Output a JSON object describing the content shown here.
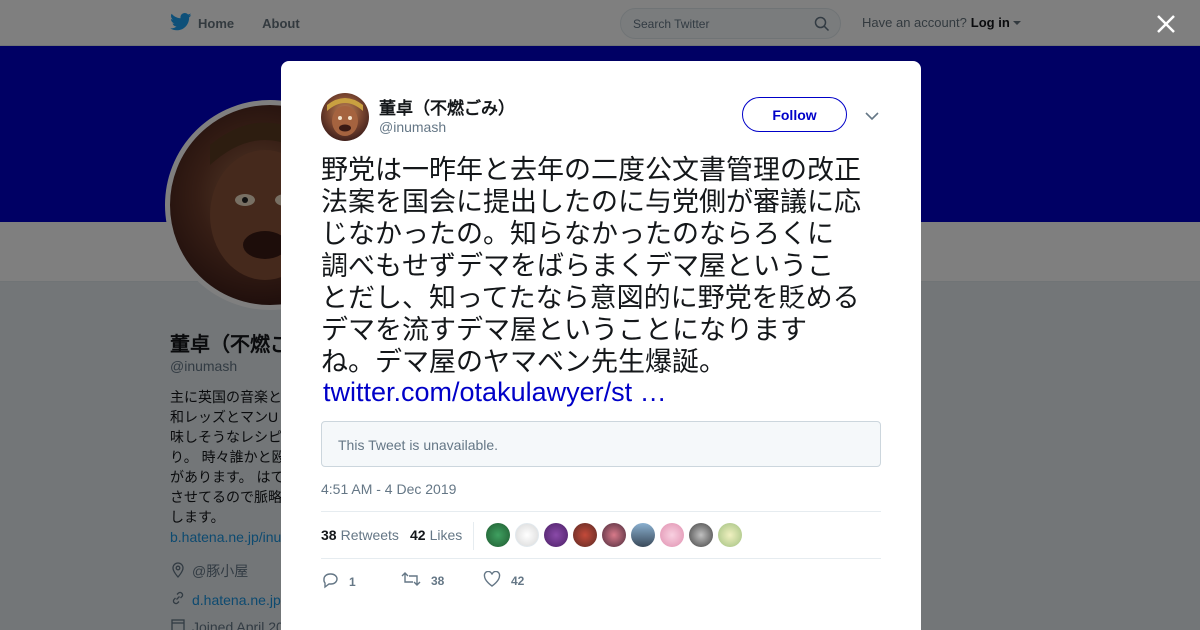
{
  "nav": {
    "home_label": "Home",
    "about_label": "About",
    "search_placeholder": "Search Twitter",
    "account_prompt": "Have an account?",
    "login_label": "Log in"
  },
  "profile": {
    "name": "董卓（不燃ごみ）",
    "handle": "@inumash",
    "bio_lines": [
      "主に英国の音楽と",
      "和レッズとマンU",
      "味しそうなレシピ",
      "り。 時々誰かと殴",
      "があります。 はて",
      "させてるので脈略",
      "します。"
    ],
    "bio_link": "b.hatena.ne.jp/inu",
    "location": "@豚小屋",
    "website": "d.hatena.ne.jp",
    "joined": "Joined April 20"
  },
  "tweet": {
    "author_name": "董卓（不燃ごみ）",
    "author_handle": "@inumash",
    "follow_label": "Follow",
    "text_lines": [
      "野党は一昨年と去年の二度公文書管理の改正",
      "法案を国会に提出したのに与党側が審議に応",
      "じなかったの。知らなかったのならろくに",
      "調べもせずデマをばらまくデマ屋というこ",
      "とだし、知ってたなら意図的に野党を貶める",
      "デマを流すデマ屋ということになります",
      "ね。デマ屋のヤマベン先生爆誕。"
    ],
    "link": "twitter.com/otakulawyer/st …",
    "quote_unavailable": "This Tweet is unavailable.",
    "timestamp": "4:51 AM - 4 Dec 2019",
    "retweets_count": "38",
    "retweets_label": "Retweets",
    "likes_count": "42",
    "likes_label": "Likes",
    "action_reply_count": "1",
    "action_retweet_count": "38",
    "action_like_count": "42"
  },
  "colors": {
    "brand": "#1da1f2",
    "accent": "#0000c8"
  }
}
